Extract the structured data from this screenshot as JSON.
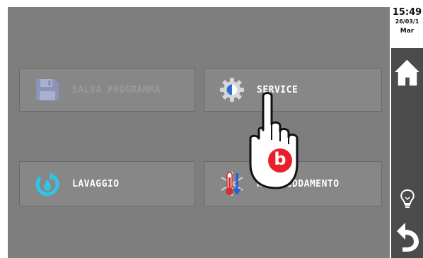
{
  "buttons": {
    "save": {
      "label": "SALVA PROGRAMMA",
      "icon": "floppy-disk-icon",
      "state": "disabled"
    },
    "service": {
      "label": "SERVICE",
      "icon": "gear-icon"
    },
    "wash": {
      "label": "LAVAGGIO",
      "icon": "rinse-cycle-icon"
    },
    "cooling": {
      "label": "RAFFREDDAMENTO",
      "icon": "thermometer-snowflake-icon"
    }
  },
  "sidebar": {
    "time": "15:49",
    "date": "26/03/1",
    "day": "Mar",
    "icons": [
      "home-icon",
      "lightbulb-icon",
      "back-arrow-icon"
    ]
  },
  "overlay": {
    "badge_letter": "b",
    "icon": "tap-hand-icon"
  },
  "colors": {
    "screen_bg": "#7e7e7e",
    "button_bg": "#878787",
    "sidebar_bg": "#4b4b4b",
    "badge_red": "#e8202a",
    "accent_cyan": "#2fc4e8"
  }
}
